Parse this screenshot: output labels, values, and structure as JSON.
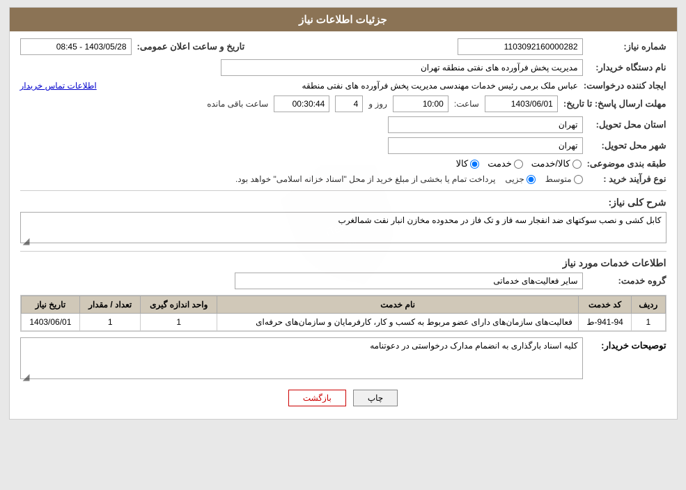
{
  "header": {
    "title": "جزئیات اطلاعات نیاز"
  },
  "fields": {
    "shomare_niaz_label": "شماره نیاز:",
    "shomare_niaz_value": "1103092160000282",
    "tarikhe_elan_label": "تاریخ و ساعت اعلان عمومی:",
    "tarikhe_elan_value": "1403/05/28 - 08:45",
    "name_dastgah_label": "نام دستگاه خریدار:",
    "name_dastgah_value": "مدیریت پخش فرآورده های نفتی منطقه تهران",
    "ijad_label": "ایجاد کننده درخواست:",
    "ijad_value": "عباس ملک برمی رئیس خدمات مهندسی مدیریت پخش فرآورده های نفتی منطقه",
    "ettelaat_tamas_label": "اطلاعات تماس خریدار",
    "mohlat_label": "مهلت ارسال پاسخ: تا تاریخ:",
    "mohlat_date": "1403/06/01",
    "mohlat_saat_label": "ساعت:",
    "mohlat_saat": "10:00",
    "mohlat_rooz_label": "روز و",
    "mohlat_rooz": "4",
    "mohlat_baqi_label": "ساعت باقی مانده",
    "mohlat_baqi": "00:30:44",
    "ostan_label": "استان محل تحویل:",
    "ostan_value": "تهران",
    "shahr_label": "شهر محل تحویل:",
    "shahr_value": "تهران",
    "tabaqe_label": "طبقه بندی موضوعی:",
    "tabaqe_kala": "کالا",
    "tabaqe_khedmat": "خدمت",
    "tabaqe_kala_khedmat": "کالا/خدمت",
    "noe_label": "نوع فرآیند خرید :",
    "noe_jazii": "جزیی",
    "noe_motawaset": "متوسط",
    "noe_desc": "پرداخت تمام یا بخشی از مبلغ خرید از محل \"اسناد خزانه اسلامی\" خواهد بود.",
    "sharh_label": "شرح کلی نیاز:",
    "sharh_value": "کابل کشی و نصب سوکتهای ضد انفجار سه فاز و تک فاز در محدوده مخازن انبار نفت شمالغرب",
    "ettelaat_section_title": "اطلاعات خدمات مورد نیاز",
    "group_khedmat_label": "گروه خدمت:",
    "group_khedmat_value": "سایر فعالیت‌های خدماتی",
    "table": {
      "headers": [
        "ردیف",
        "کد خدمت",
        "نام خدمت",
        "واحد اندازه گیری",
        "تعداد / مقدار",
        "تاریخ نیاز"
      ],
      "rows": [
        {
          "radif": "1",
          "kod": "941-94-ط",
          "nam": "فعالیت‌های سازمان‌های دارای عضو مربوط به کسب و کار، کارفرمایان و سازمان‌های حرفه‌ای",
          "vahed": "1",
          "tedad": "1",
          "tarikh": "1403/06/01"
        }
      ]
    },
    "tawzih_label": "توصیحات خریدار:",
    "tawzih_value": "کلیه اسناد بارگذاری به انضمام مدارک درخواستی در دعوتنامه",
    "btn_back": "بازگشت",
    "btn_print": "چاپ"
  }
}
